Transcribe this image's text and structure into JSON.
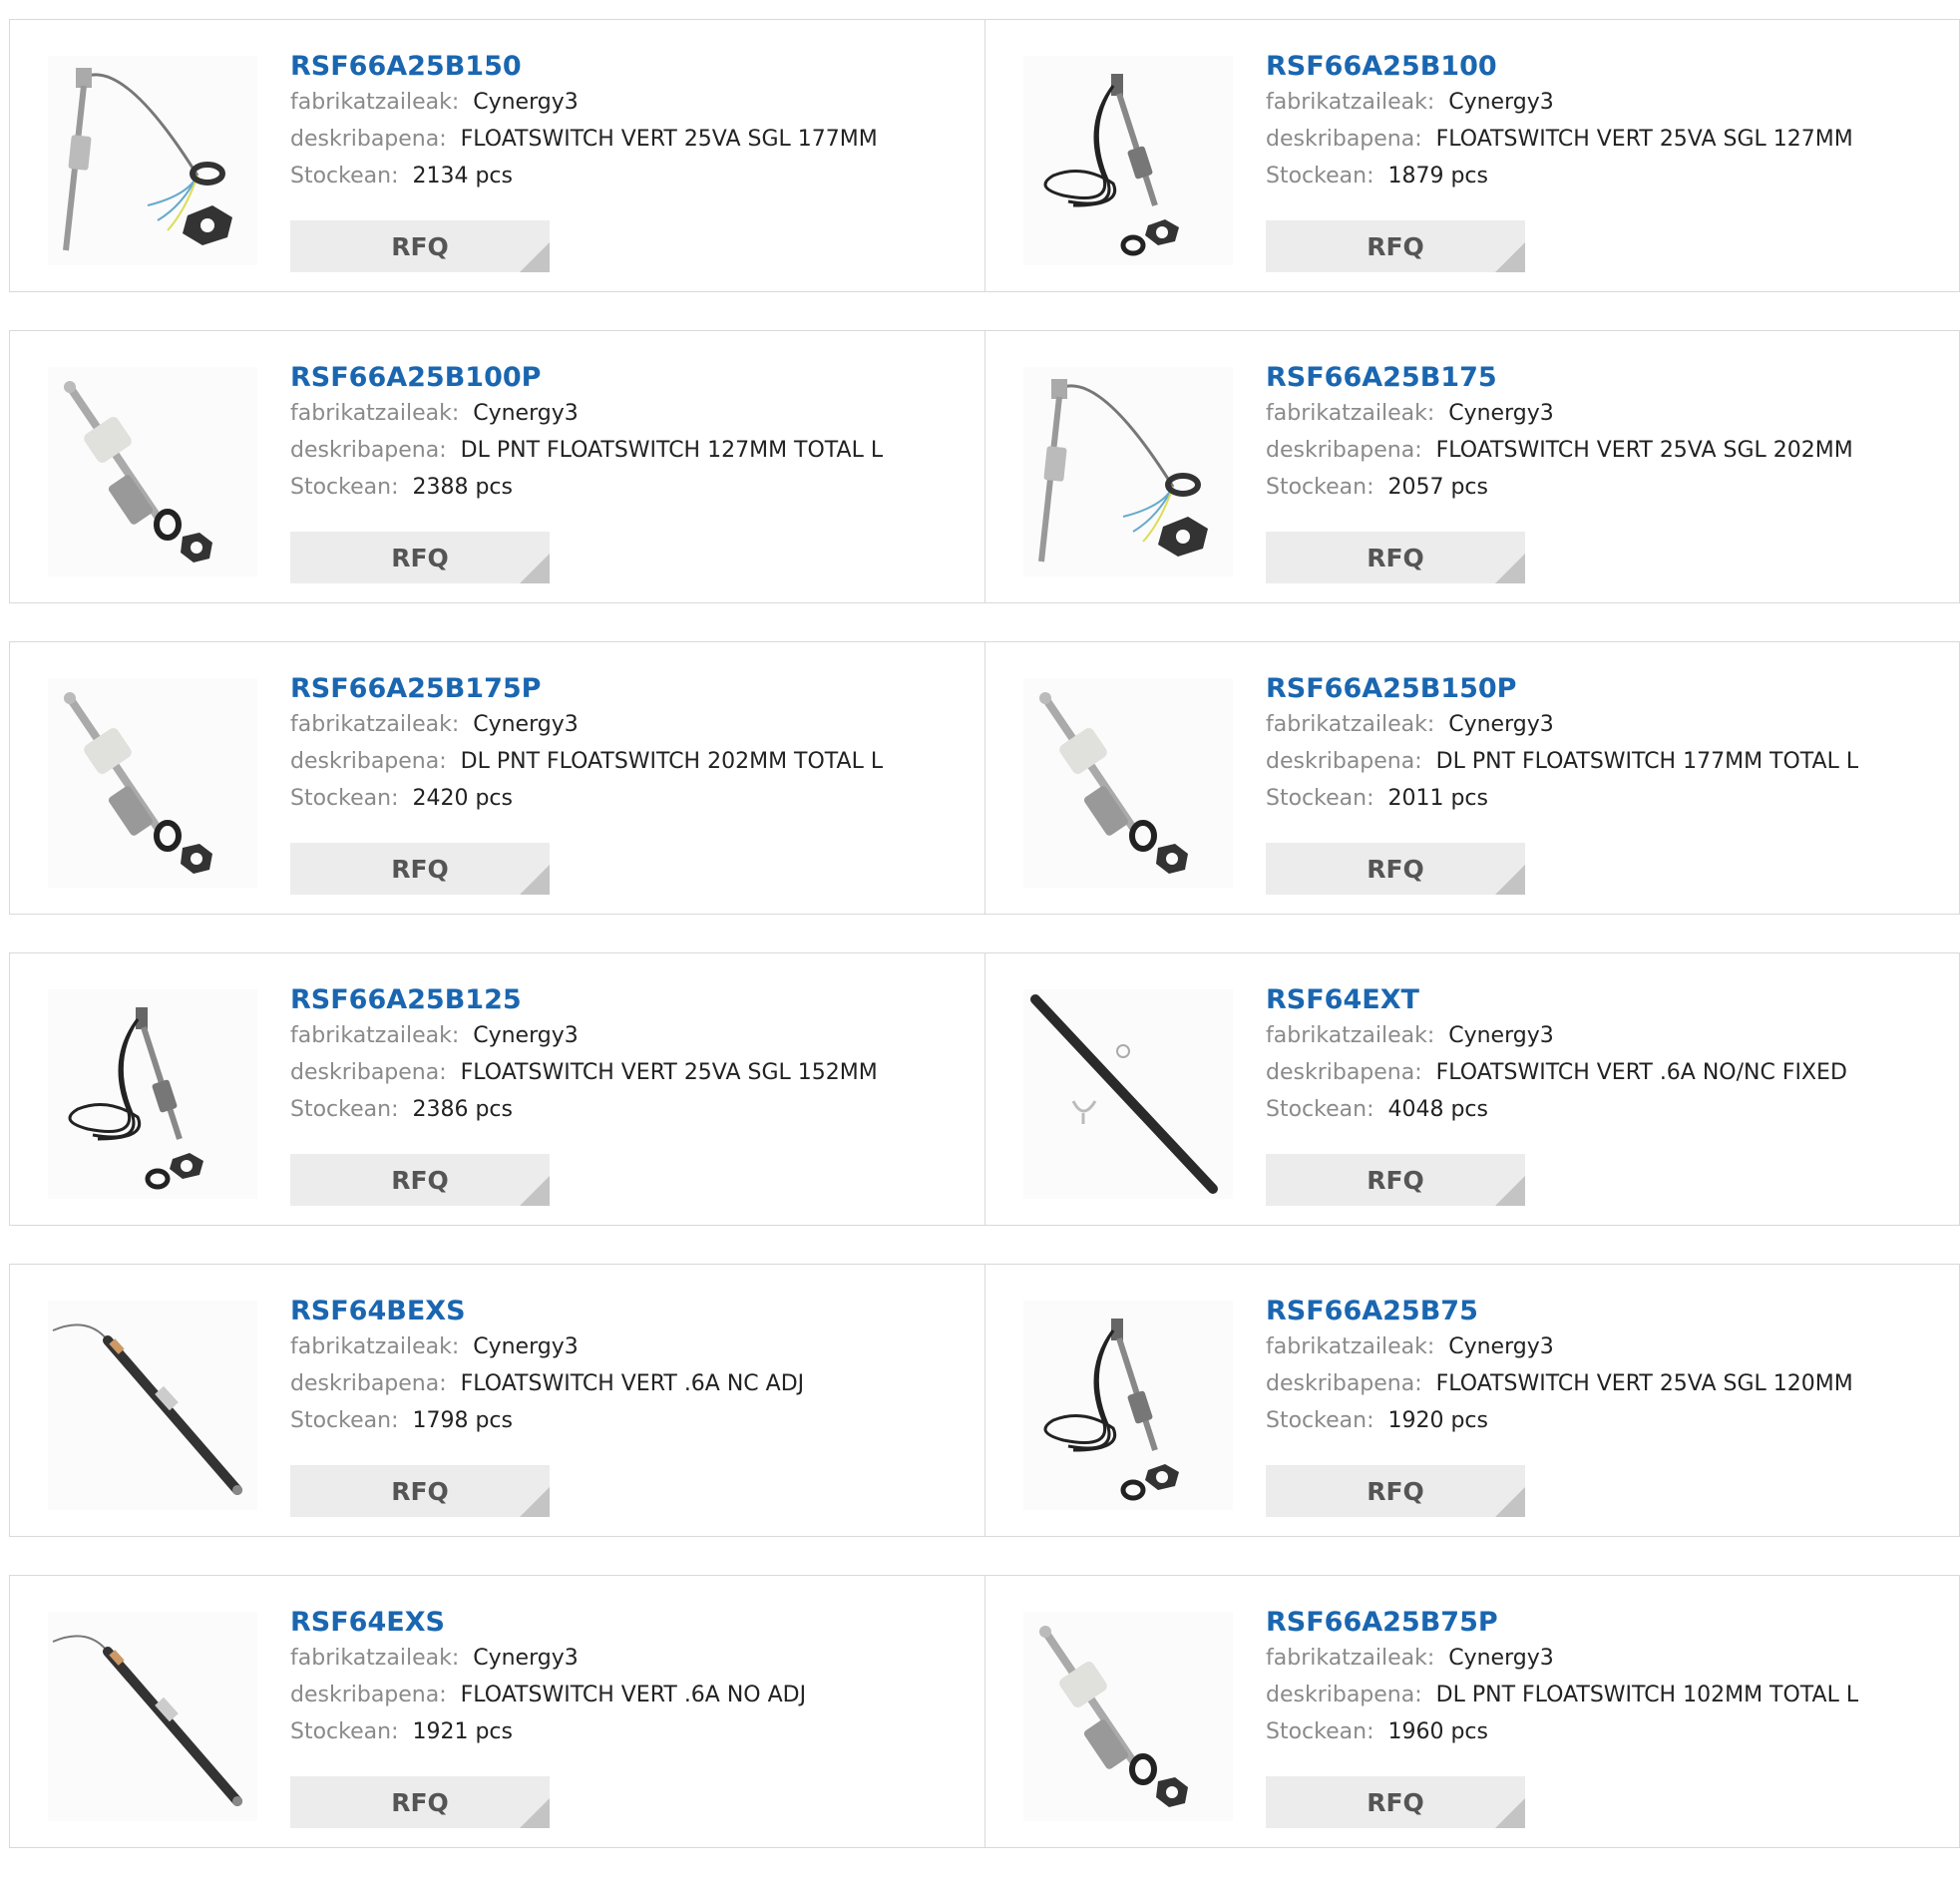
{
  "labels": {
    "manufacturer": "fabrikatzaileak:",
    "description": "deskribapena:",
    "stock": "Stockean:",
    "rfq": "RFQ"
  },
  "products": [
    {
      "part_number": "RSF66A25B150",
      "manufacturer": "Cynergy3",
      "description": "FLOATSWITCH VERT 25VA SGL 177MM",
      "stock": "2134 pcs",
      "image": "cable-floatswitch-icon"
    },
    {
      "part_number": "RSF66A25B100",
      "manufacturer": "Cynergy3",
      "description": "FLOATSWITCH VERT 25VA SGL 127MM",
      "stock": "1879 pcs",
      "image": "coiled-floatswitch-icon"
    },
    {
      "part_number": "RSF66A25B100P",
      "manufacturer": "Cynergy3",
      "description": "DL PNT FLOATSWITCH 127MM TOTAL L",
      "stock": "2388 pcs",
      "image": "plastic-floatswitch-icon"
    },
    {
      "part_number": "RSF66A25B175",
      "manufacturer": "Cynergy3",
      "description": "FLOATSWITCH VERT 25VA SGL 202MM",
      "stock": "2057 pcs",
      "image": "cable-floatswitch-icon"
    },
    {
      "part_number": "RSF66A25B175P",
      "manufacturer": "Cynergy3",
      "description": "DL PNT FLOATSWITCH 202MM TOTAL L",
      "stock": "2420 pcs",
      "image": "plastic-floatswitch-icon"
    },
    {
      "part_number": "RSF66A25B150P",
      "manufacturer": "Cynergy3",
      "description": "DL PNT FLOATSWITCH 177MM TOTAL L",
      "stock": "2011 pcs",
      "image": "plastic-floatswitch-icon"
    },
    {
      "part_number": "RSF66A25B125",
      "manufacturer": "Cynergy3",
      "description": "FLOATSWITCH VERT 25VA SGL 152MM",
      "stock": "2386 pcs",
      "image": "coiled-floatswitch-icon"
    },
    {
      "part_number": "RSF64EXT",
      "manufacturer": "Cynergy3",
      "description": "FLOATSWITCH VERT .6A NO/NC FIXED",
      "stock": "4048 pcs",
      "image": "rod-floatswitch-icon"
    },
    {
      "part_number": "RSF64BEXS",
      "manufacturer": "Cynergy3",
      "description": "FLOATSWITCH VERT .6A NC ADJ",
      "stock": "1798 pcs",
      "image": "slim-floatswitch-icon"
    },
    {
      "part_number": "RSF66A25B75",
      "manufacturer": "Cynergy3",
      "description": "FLOATSWITCH VERT 25VA SGL 120MM",
      "stock": "1920 pcs",
      "image": "coiled-floatswitch-icon"
    },
    {
      "part_number": "RSF64EXS",
      "manufacturer": "Cynergy3",
      "description": "FLOATSWITCH VERT .6A NO ADJ",
      "stock": "1921 pcs",
      "image": "slim-floatswitch-icon"
    },
    {
      "part_number": "RSF66A25B75P",
      "manufacturer": "Cynergy3",
      "description": "DL PNT FLOATSWITCH 102MM TOTAL L",
      "stock": "1960 pcs",
      "image": "plastic-floatswitch-icon"
    }
  ]
}
